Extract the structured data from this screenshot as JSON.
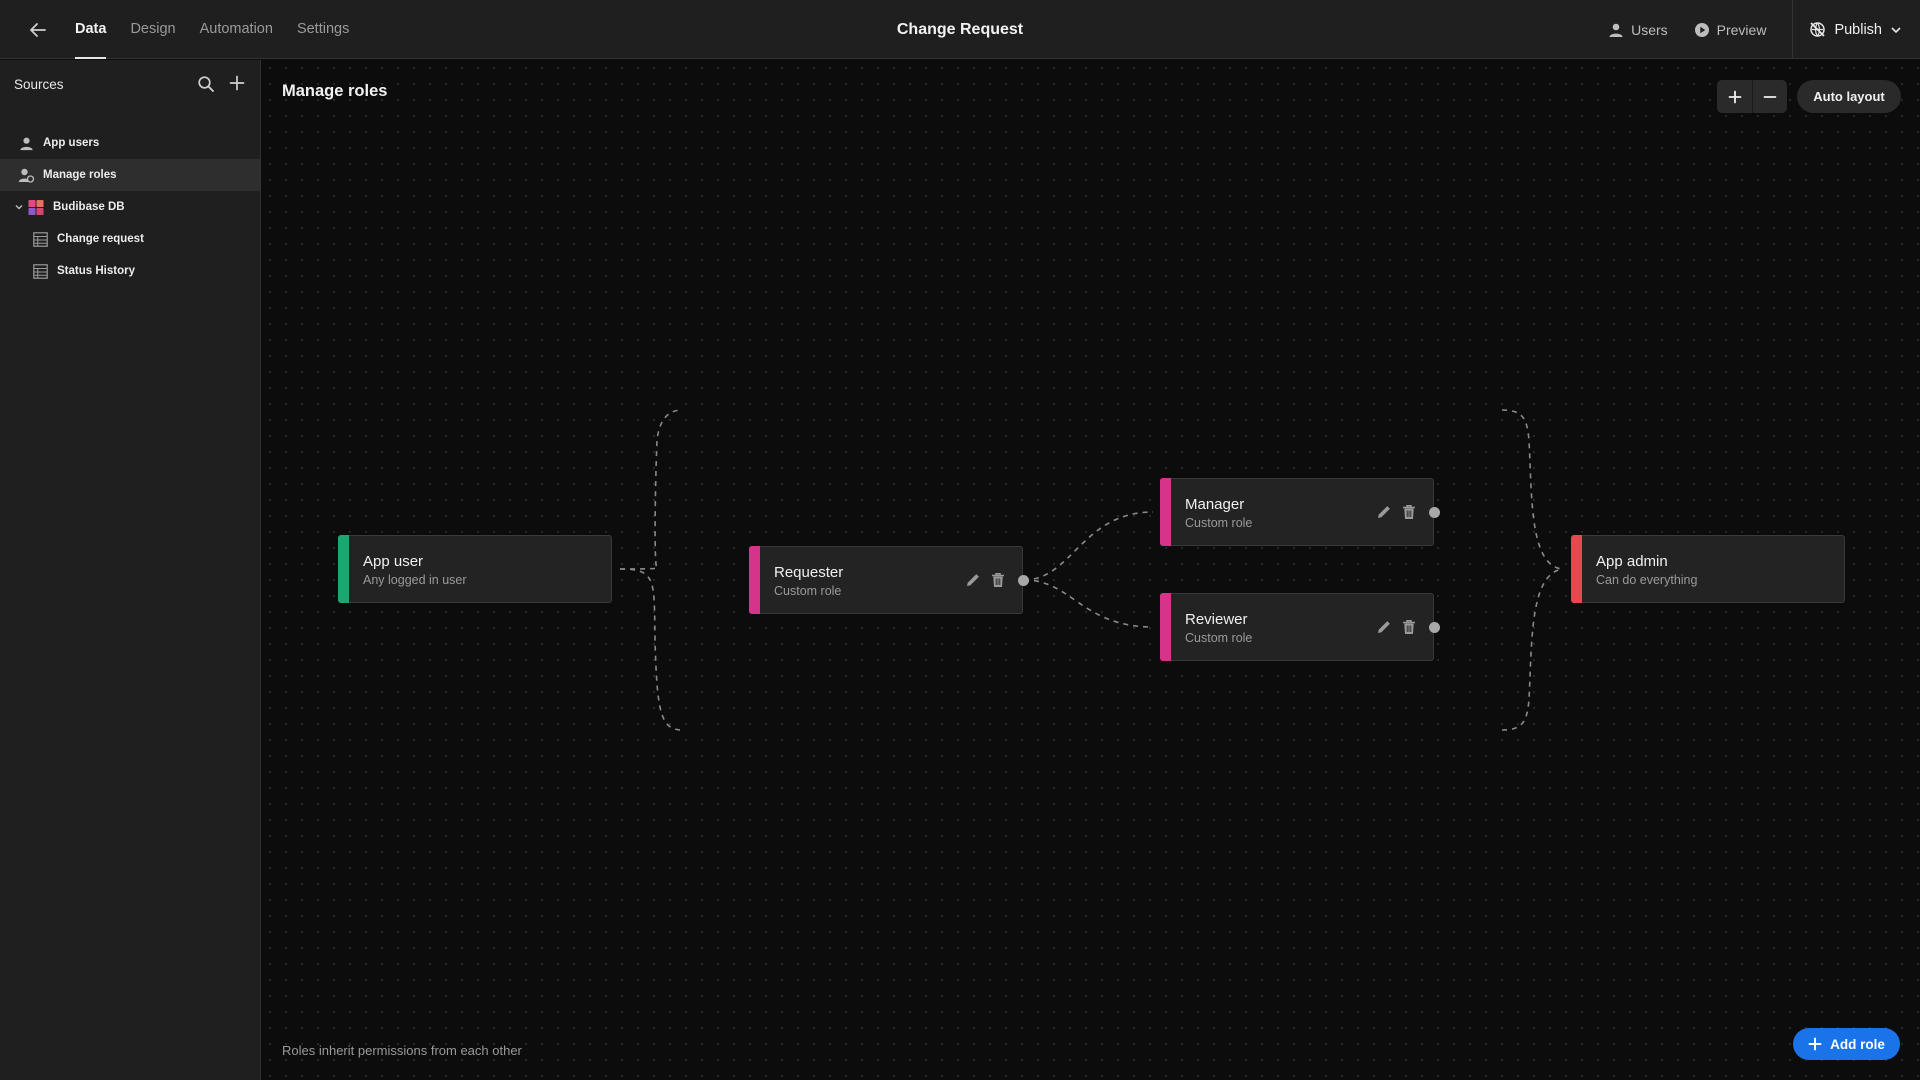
{
  "app": {
    "title": "Change Request"
  },
  "nav": {
    "tabs": [
      {
        "label": "Data"
      },
      {
        "label": "Design"
      },
      {
        "label": "Automation"
      },
      {
        "label": "Settings"
      }
    ]
  },
  "top_actions": {
    "users": "Users",
    "preview": "Preview",
    "publish": "Publish"
  },
  "sidebar": {
    "title": "Sources",
    "items": [
      {
        "label": "App users",
        "icon": "user-icon"
      },
      {
        "label": "Manage roles",
        "icon": "user-roles-icon",
        "selected": true
      },
      {
        "label": "Budibase DB",
        "icon": "budibase-db-logo",
        "expanded": true
      },
      {
        "label": "Change request",
        "icon": "table-icon"
      },
      {
        "label": "Status History",
        "icon": "table-icon"
      }
    ]
  },
  "canvas": {
    "title": "Manage roles",
    "auto_layout": "Auto layout",
    "hint": "Roles inherit permissions from each other",
    "add_role": "Add role",
    "roles": [
      {
        "name": "App user",
        "description": "Any logged in user",
        "color": "#1ea672"
      },
      {
        "name": "Requester",
        "description": "Custom role",
        "color": "#d6338a"
      },
      {
        "name": "Manager",
        "description": "Custom role",
        "color": "#d6338a"
      },
      {
        "name": "Reviewer",
        "description": "Custom role",
        "color": "#d6338a"
      },
      {
        "name": "App admin",
        "description": "Can do everything",
        "color": "#e8474f"
      }
    ]
  },
  "colors": {
    "accent": "#1a73e8",
    "background": "#0b0b0b",
    "panel": "#1f1f1f"
  }
}
